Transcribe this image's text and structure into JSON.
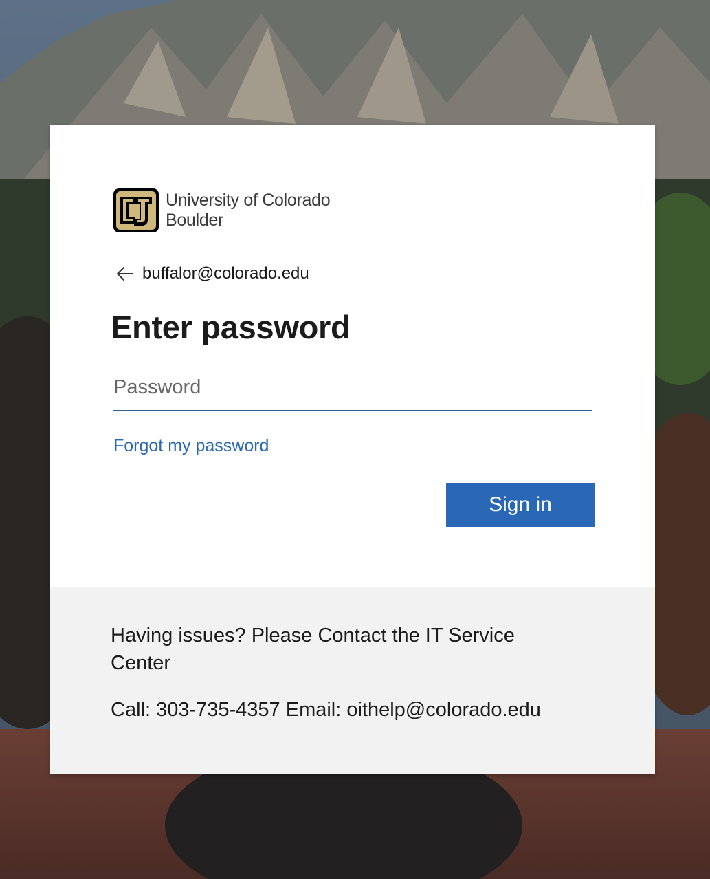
{
  "background": {
    "description_icon": "mountain-buffalo-photo"
  },
  "brand": {
    "line1": "University of Colorado",
    "line2": "Boulder",
    "logo_icon": "cu-logo-icon",
    "colors": {
      "gold": "#cfb87c",
      "black": "#000000"
    }
  },
  "identity": {
    "email": "buffalor@colorado.edu",
    "back_icon": "back-arrow-icon"
  },
  "form": {
    "title": "Enter password",
    "password_placeholder": "Password",
    "password_value": "",
    "forgot_label": "Forgot my password",
    "signin_label": "Sign in"
  },
  "footer": {
    "help": "Having issues? Please Contact the IT Service Center",
    "contact": "Call: 303-735-4357 Email: oithelp@colorado.edu"
  },
  "colors": {
    "accent": "#2a67b6",
    "link": "#2a67b1",
    "footer_bg": "#f2f2f2"
  }
}
